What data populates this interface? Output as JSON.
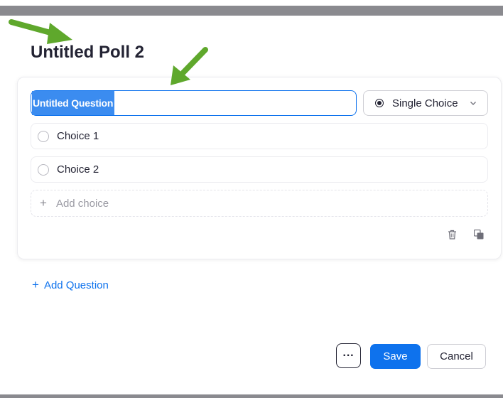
{
  "poll": {
    "title": "Untitled Poll 2"
  },
  "question": {
    "text": "Untitled Question",
    "type_label": "Single Choice",
    "choices": [
      "Choice 1",
      "Choice 2"
    ],
    "add_choice_label": "Add choice",
    "add_choice_icon": "+"
  },
  "add_question": {
    "icon": "+",
    "label": "Add Question"
  },
  "footer": {
    "more_label": "···",
    "save_label": "Save",
    "cancel_label": "Cancel"
  },
  "colors": {
    "accent": "#0e72ed",
    "selection": "#3b8cf0",
    "annotation_arrow": "#5fa82c"
  },
  "icons": {
    "type_radio": "radio-selected-icon",
    "type_chevron": "chevron-down-icon",
    "delete": "trash-icon",
    "duplicate": "copy-icon",
    "annotation": "green-arrow-icon"
  }
}
